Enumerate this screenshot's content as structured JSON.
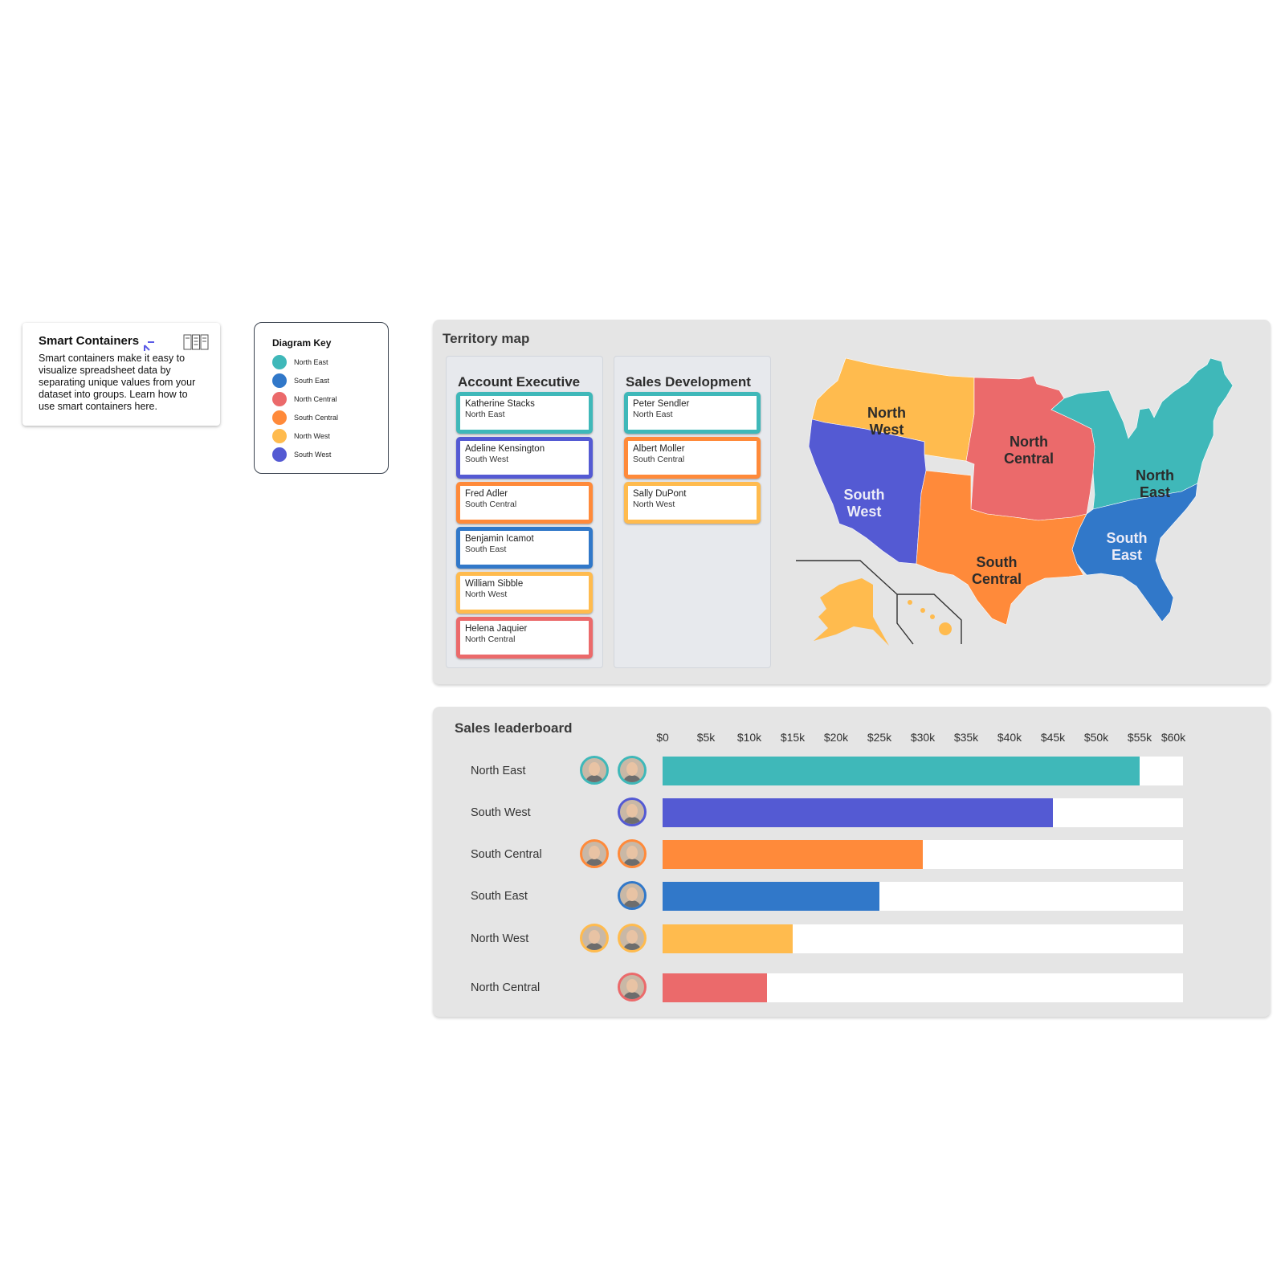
{
  "smart_containers": {
    "title": "Smart Containers",
    "description": "Smart containers make it easy to visualize spreadsheet data by separating unique values from your dataset into groups. Learn how to use smart containers here.",
    "icon": "smart-container-icon"
  },
  "diagram_key": {
    "title": "Diagram Key",
    "items": [
      {
        "label": "North East",
        "color": "#3fb8b9"
      },
      {
        "label": "South East",
        "color": "#3178c9"
      },
      {
        "label": "North Central",
        "color": "#eb6a6b"
      },
      {
        "label": "South Central",
        "color": "#ff8a3a"
      },
      {
        "label": "North West",
        "color": "#ffbb4e"
      },
      {
        "label": "South West",
        "color": "#545ad3"
      }
    ]
  },
  "territory_map": {
    "title": "Territory map",
    "columns": [
      {
        "title": "Account Executive",
        "people": [
          {
            "name": "Katherine Stacks",
            "region": "North East",
            "color": "#3fb8b9"
          },
          {
            "name": "Adeline Kensington",
            "region": "South West",
            "color": "#545ad3"
          },
          {
            "name": "Fred Adler",
            "region": "South Central",
            "color": "#ff8a3a"
          },
          {
            "name": "Benjamin Icamot",
            "region": "South East",
            "color": "#3178c9"
          },
          {
            "name": "William Sibble",
            "region": "North West",
            "color": "#ffbb4e"
          },
          {
            "name": "Helena Jaquier",
            "region": "North Central",
            "color": "#eb6a6b"
          }
        ]
      },
      {
        "title": "Sales Development",
        "people": [
          {
            "name": "Peter Sendler",
            "region": "North East",
            "color": "#3fb8b9"
          },
          {
            "name": "Albert Moller",
            "region": "South Central",
            "color": "#ff8a3a"
          },
          {
            "name": "Sally DuPont",
            "region": "North West",
            "color": "#ffbb4e"
          }
        ]
      }
    ],
    "map_labels": {
      "north_west": [
        "North",
        "West"
      ],
      "south_west": [
        "South",
        "West"
      ],
      "north_central": [
        "North",
        "Central"
      ],
      "south_central": [
        "South",
        "Central"
      ],
      "north_east": [
        "North",
        "East"
      ],
      "south_east": [
        "South",
        "East"
      ]
    }
  },
  "chart_data": {
    "type": "bar",
    "orientation": "horizontal",
    "title": "Sales leaderboard",
    "categories": [
      "North East",
      "South West",
      "South Central",
      "South East",
      "North West",
      "North Central"
    ],
    "values": [
      55000,
      45000,
      30000,
      25000,
      15000,
      12000
    ],
    "colors": [
      "#3fb8b9",
      "#545ad3",
      "#ff8a3a",
      "#3178c9",
      "#ffbb4e",
      "#eb6a6b"
    ],
    "avatars_per_row": [
      2,
      1,
      2,
      1,
      2,
      1
    ],
    "xlim": [
      0,
      60000
    ],
    "tick_labels": [
      "$0",
      "$5k",
      "$10k",
      "$15k",
      "$20k",
      "$25k",
      "$30k",
      "$35k",
      "$40k",
      "$45k",
      "$50k",
      "$55k",
      "$60k"
    ],
    "xlabel": "",
    "ylabel": "",
    "grid": false,
    "legend": "none"
  }
}
